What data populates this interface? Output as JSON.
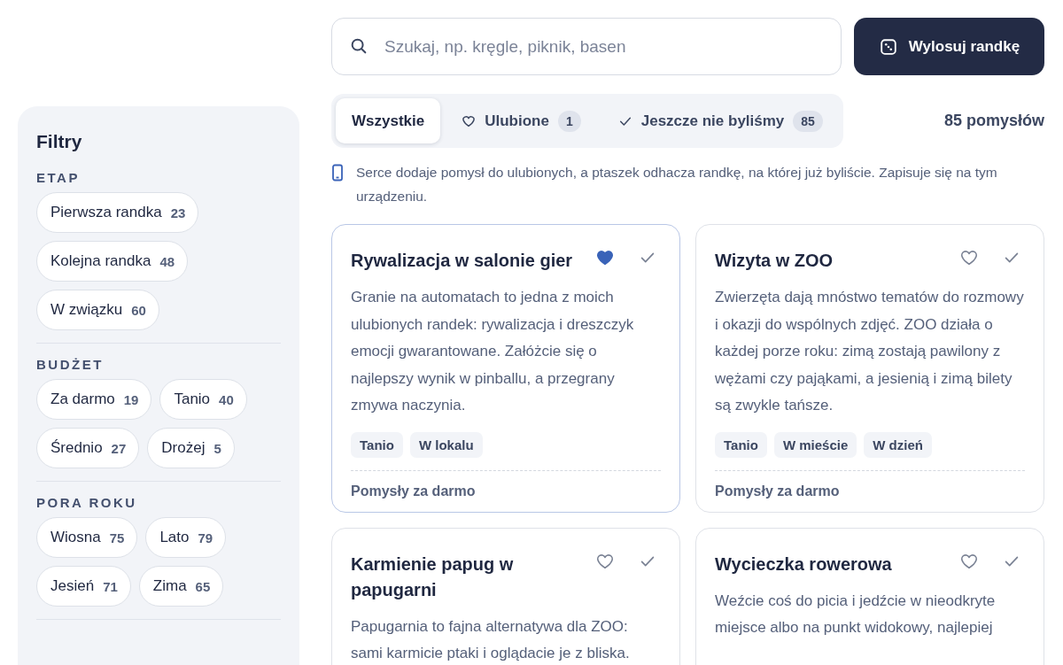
{
  "search": {
    "placeholder": "Szukaj, np. kręgle, piknik, basen"
  },
  "random_button": {
    "label": "Wylosuj randkę"
  },
  "filters": {
    "title": "Filtry",
    "groups": [
      {
        "label": "ETAP",
        "chips": [
          {
            "label": "Pierwsza randka",
            "count": "23"
          },
          {
            "label": "Kolejna randka",
            "count": "48"
          },
          {
            "label": "W związku",
            "count": "60"
          }
        ]
      },
      {
        "label": "BUDŻET",
        "chips": [
          {
            "label": "Za darmo",
            "count": "19"
          },
          {
            "label": "Tanio",
            "count": "40"
          },
          {
            "label": "Średnio",
            "count": "27"
          },
          {
            "label": "Drożej",
            "count": "5"
          }
        ]
      },
      {
        "label": "PORA ROKU",
        "chips": [
          {
            "label": "Wiosna",
            "count": "75"
          },
          {
            "label": "Lato",
            "count": "79"
          },
          {
            "label": "Jesień",
            "count": "71"
          },
          {
            "label": "Zima",
            "count": "65"
          }
        ]
      }
    ]
  },
  "tabs": [
    {
      "label": "Wszystkie",
      "kind": "all",
      "selected": true
    },
    {
      "label": "Ulubione",
      "kind": "heart",
      "count": "1",
      "selected": false
    },
    {
      "label": "Jeszcze nie byliśmy",
      "kind": "check",
      "count": "85",
      "selected": false
    }
  ],
  "result_count": "85 pomysłów",
  "notice": "Serce dodaje pomysł do ulubionych, a ptaszek odhacza randkę, na której już byliście. Zapisuje się na tym urządzeniu.",
  "cards": [
    {
      "title": "Rywalizacja w salonie gier",
      "favorite": true,
      "done": false,
      "description": "Granie na automatach to jedna z moich ulubionych randek: rywalizacja i dreszczyk emocji gwarantowane. Załóżcie się o najlepszy wynik w pinballu, a przegrany zmywa naczynia.",
      "tags": [
        "Tanio",
        "W lokalu"
      ],
      "footer": "Pomysły za darmo"
    },
    {
      "title": "Wizyta w ZOO",
      "favorite": false,
      "done": false,
      "description": "Zwierzęta dają mnóstwo tematów do rozmowy i okazji do wspólnych zdjęć. ZOO działa o każdej porze roku: zimą zostają pawilony z wężami czy pająkami, a jesienią i zimą bilety są zwykle tańsze.",
      "tags": [
        "Tanio",
        "W mieście",
        "W dzień"
      ],
      "footer": "Pomysły za darmo"
    },
    {
      "title": "Karmienie papug w papugarni",
      "favorite": false,
      "done": false,
      "description": "Papugarnia to fajna alternatywa dla ZOO: sami karmicie ptaki i oglądacie je z bliska."
    },
    {
      "title": "Wycieczka rowerowa",
      "favorite": false,
      "done": false,
      "description": "Weźcie coś do picia i jedźcie w nieodkryte miejsce albo na punkt widokowy, najlepiej"
    }
  ]
}
